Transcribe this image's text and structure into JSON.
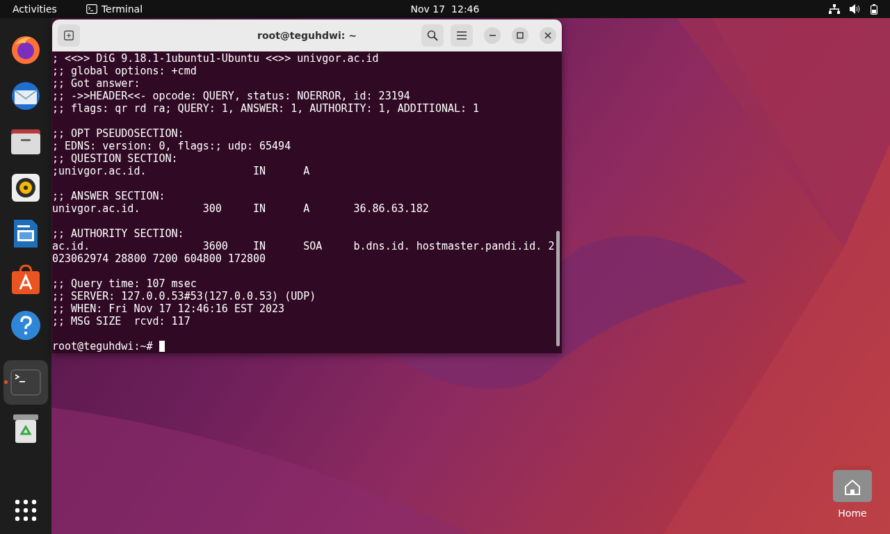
{
  "top_bar": {
    "activities": "Activities",
    "app_menu": "Terminal",
    "clock": "Nov 17  12:46"
  },
  "dock": {
    "items": [
      {
        "kind": "firefox",
        "active": false
      },
      {
        "kind": "mail",
        "active": false
      },
      {
        "kind": "files",
        "active": false
      },
      {
        "kind": "music",
        "active": false
      },
      {
        "kind": "writer",
        "active": false
      },
      {
        "kind": "store",
        "active": false
      },
      {
        "kind": "help",
        "active": false
      },
      {
        "kind": "terminal",
        "active": true
      },
      {
        "kind": "trash",
        "active": false
      }
    ]
  },
  "terminal": {
    "title": "root@teguhdwi: ~",
    "blocks": [
      {
        "lines": [
          "; <<>> DiG 9.18.1-1ubuntu1-Ubuntu <<>> univgor.ac.id",
          ";; global options: +cmd",
          ";; Got answer:",
          ";; ->>HEADER<<- opcode: QUERY, status: NOERROR, id: 23194",
          ";; flags: qr rd ra; QUERY: 1, ANSWER: 1, AUTHORITY: 1, ADDITIONAL: 1"
        ]
      },
      {
        "lines": [
          ";; OPT PSEUDOSECTION:",
          "; EDNS: version: 0, flags:; udp: 65494",
          ";; QUESTION SECTION:",
          ";univgor.ac.id.                 IN      A"
        ]
      },
      {
        "lines": [
          ";; ANSWER SECTION:",
          "univgor.ac.id.          300     IN      A       36.86.63.182"
        ]
      },
      {
        "lines": [
          ";; AUTHORITY SECTION:",
          "ac.id.                  3600    IN      SOA     b.dns.id. hostmaster.pandi.id. 2",
          "023062974 28800 7200 604800 172800"
        ]
      },
      {
        "lines": [
          ";; Query time: 107 msec",
          ";; SERVER: 127.0.0.53#53(127.0.0.53) (UDP)",
          ";; WHEN: Fri Nov 17 12:46:16 EST 2023",
          ";; MSG SIZE  rcvd: 117"
        ]
      }
    ],
    "prompt": "root@teguhdwi:~#"
  },
  "desktop_icons": [
    {
      "label": "Home"
    }
  ]
}
